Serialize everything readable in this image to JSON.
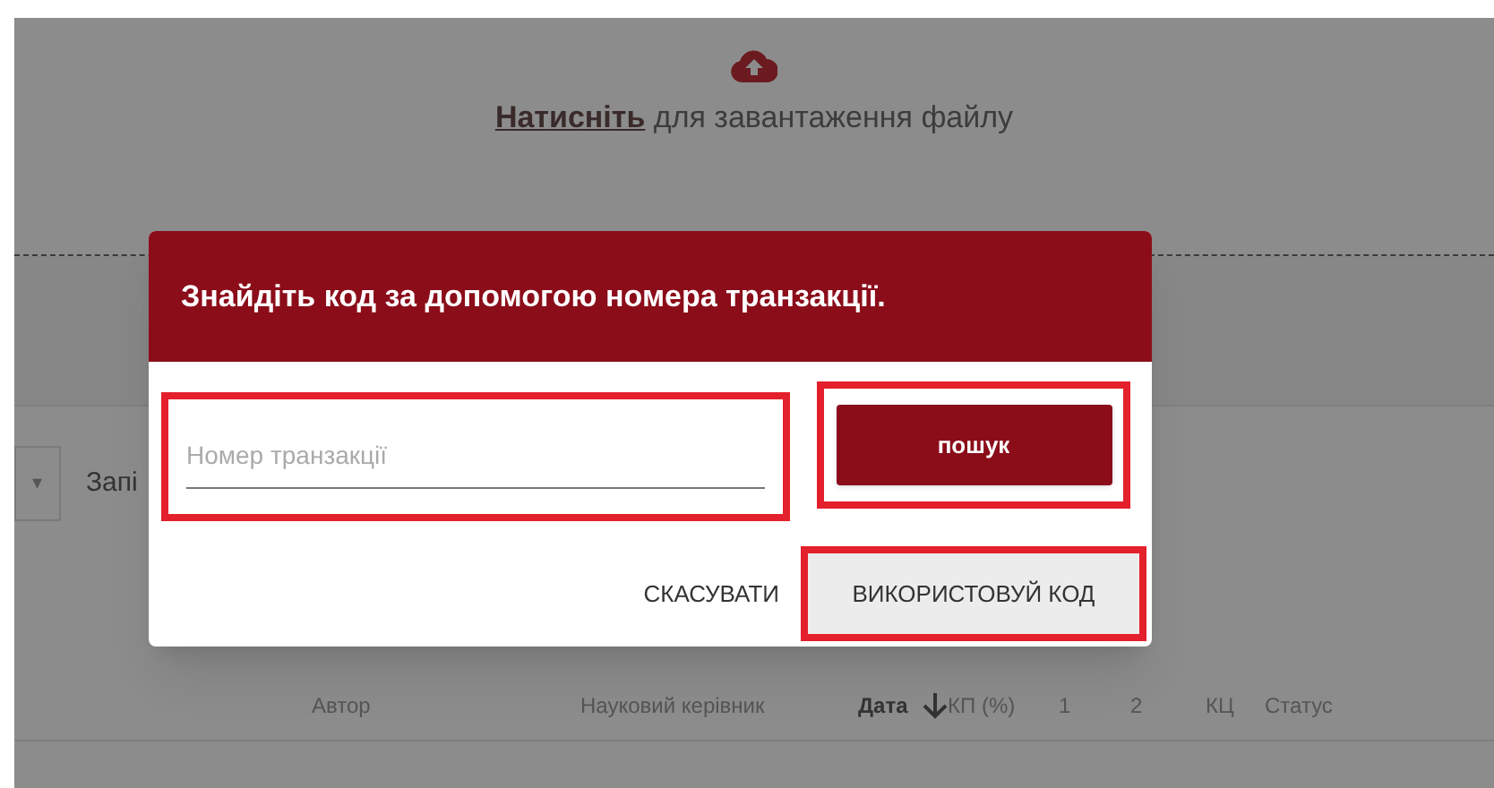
{
  "upload": {
    "link": "Натисніть",
    "text": "для завантаження файлу"
  },
  "filter": {
    "caret": "▾",
    "label": "Запі"
  },
  "table": {
    "columns": [
      {
        "label": "Автор",
        "sorted": false
      },
      {
        "label": "Науковий керівник",
        "sorted": false
      },
      {
        "label": "Дата",
        "sorted": true
      },
      {
        "label": "КП (%)",
        "sorted": false
      },
      {
        "label": "1",
        "sorted": false
      },
      {
        "label": "2",
        "sorted": false
      },
      {
        "label": "КЦ",
        "sorted": false
      },
      {
        "label": "Статус",
        "sorted": false
      }
    ]
  },
  "dialog": {
    "title": "Знайдіть код за допомогою номера транзакції.",
    "field": {
      "placeholder": "Номер транзакції"
    },
    "search_button": "пошук",
    "cancel_button": "СКАСУВАТИ",
    "use_code_button": "ВИКОРИСТОВУЙ КОД"
  }
}
